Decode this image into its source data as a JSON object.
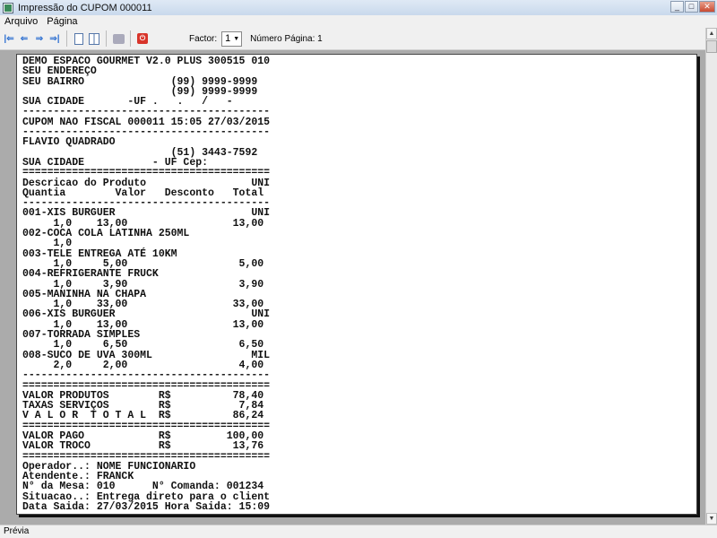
{
  "window": {
    "title": "Impressão do CUPOM 000011"
  },
  "menu": [
    "Arquivo",
    "Página"
  ],
  "toolbar": {
    "factor_label": "Factor:",
    "factor_value": "1",
    "page_label": "Número Página: 1"
  },
  "receipt": [
    "DEMO ESPACO GOURMET V2.0 PLUS 300515 010",
    "SEU ENDEREÇO",
    "SEU BAIRRO              (99) 9999-9999",
    "                        (99) 9999-9999",
    "SUA CIDADE       -UF .   .   /   -",
    "----------------------------------------",
    "CUPOM NAO FISCAL 000011 15:05 27/03/2015",
    "----------------------------------------",
    "FLAVIO QUADRADO",
    "                        (51) 3443-7592",
    "SUA CIDADE           - UF Cep:",
    "========================================",
    "Descricao do Produto                 UNI",
    "Quantia        Valor   Desconto   Total",
    "----------------------------------------",
    "001-XIS BURGUER                      UNI",
    "     1,0    13,00                 13,00",
    "002-COCA COLA LATINHA 250ML",
    "     1,0",
    "003-TELE ENTREGA ATÉ 10KM",
    "     1,0     5,00                  5,00",
    "004-REFRIGERANTE FRUCK",
    "     1,0     3,90                  3,90",
    "005-MANINHA NA CHAPA",
    "     1,0    33,00                 33,00",
    "006-XIS BURGUER                      UNI",
    "     1,0    13,00                 13,00",
    "007-TORRADA SIMPLES",
    "     1,0     6,50                  6,50",
    "008-SUCO DE UVA 300ML                MIL",
    "     2,0     2,00                  4,00",
    "----------------------------------------",
    "========================================",
    "VALOR PRODUTOS        R$          78,40",
    "TAXAS SERVIÇOS        R$           7,84",
    "V A L O R  T O T A L  R$          86,24",
    "========================================",
    "VALOR PAGO            R$         100,00",
    "VALOR TROCO           R$          13,76",
    "========================================",
    "Operador..: NOME FUNCIONARIO",
    "Atendente.: FRANCK",
    "N° da Mesa: 010      N° Comanda: 001234",
    "Situacao..: Entrega direto para o client",
    "Data Saida: 27/03/2015 Hora Saida: 15:09"
  ],
  "status": {
    "text": "Prévia"
  },
  "icons": [
    "first-page-icon",
    "previous-page-icon",
    "next-page-icon",
    "last-page-icon",
    "single-page-icon",
    "two-pages-icon",
    "print-icon",
    "stop-icon"
  ]
}
